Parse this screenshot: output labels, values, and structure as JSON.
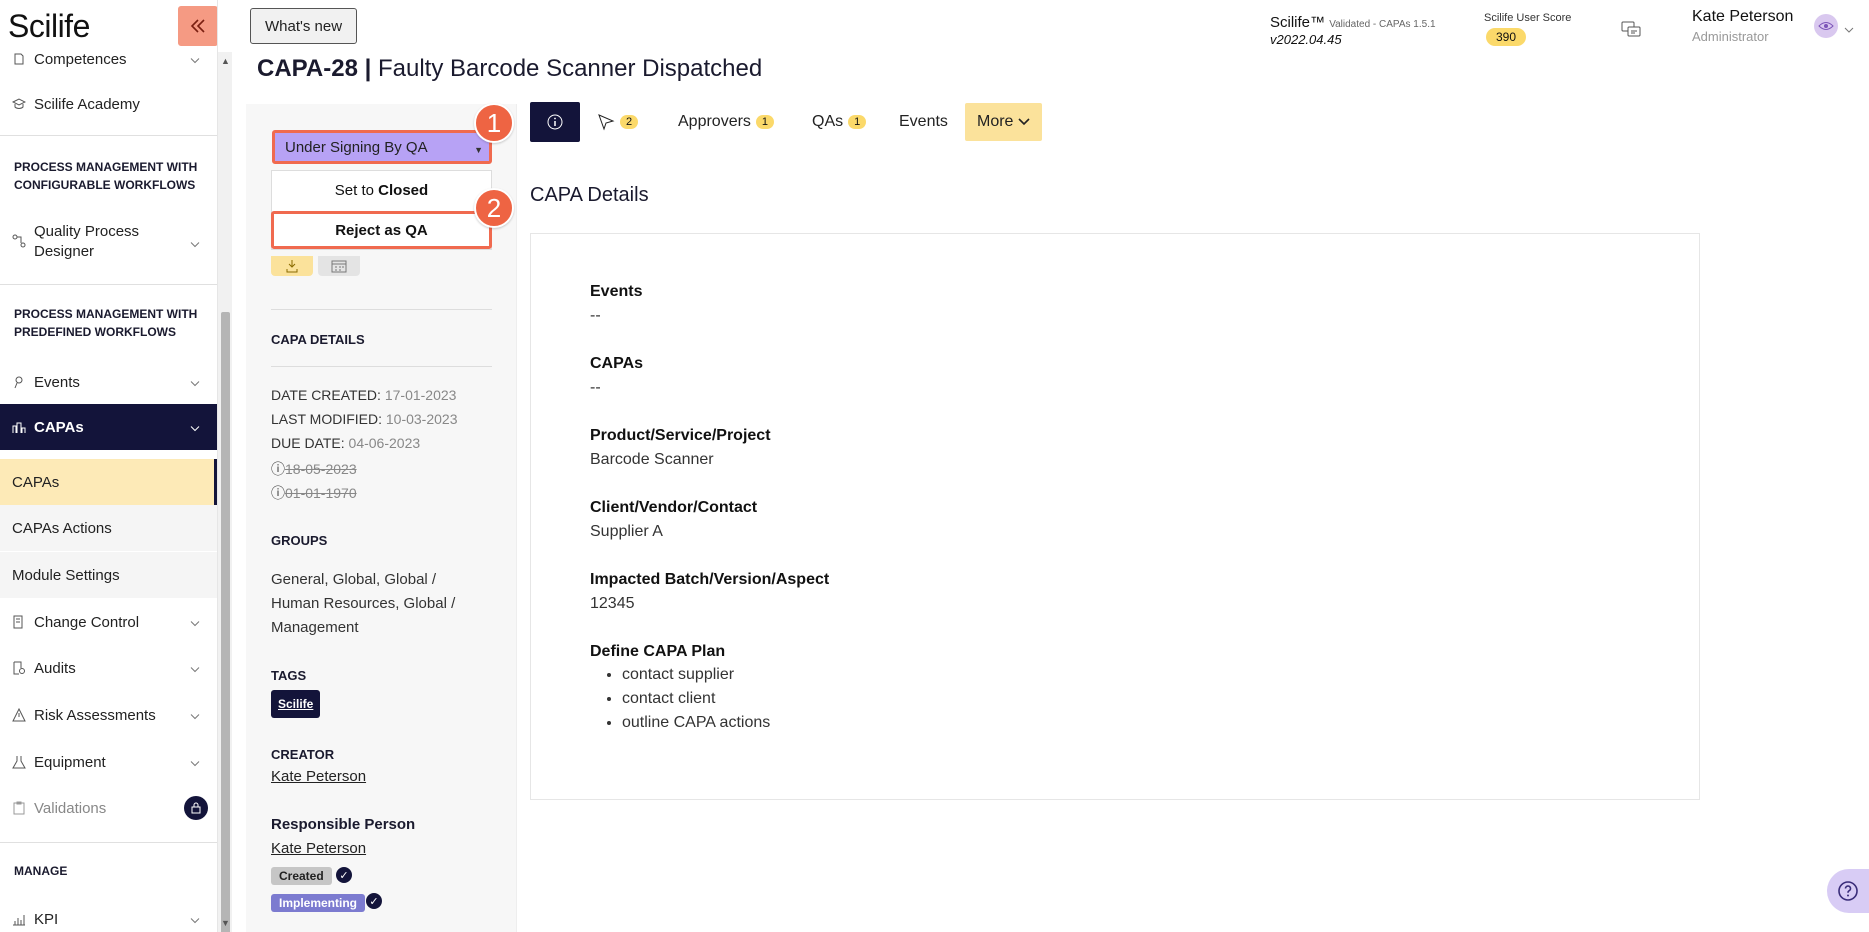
{
  "app": {
    "logo": "Scilife"
  },
  "sidebar": {
    "items_top": [
      {
        "label": "Competences"
      },
      {
        "label": "Scilife Academy"
      }
    ],
    "section_configurable": "PROCESS MANAGEMENT WITH CONFIGURABLE WORKFLOWS",
    "quality_designer": "Quality Process Designer",
    "section_predefined": "PROCESS MANAGEMENT WITH PREDEFINED WORKFLOWS",
    "events": "Events",
    "capas": "CAPAs",
    "sub": {
      "capas": "CAPAs",
      "capas_actions": "CAPAs Actions",
      "module_settings": "Module Settings"
    },
    "change_control": "Change Control",
    "audits": "Audits",
    "risk_assessments": "Risk Assessments",
    "equipment": "Equipment",
    "validations": "Validations",
    "section_manage": "MANAGE",
    "kpi": "KPI"
  },
  "topbar": {
    "whats_new": "What's new",
    "product": "Scilife™",
    "validated": "Validated - CAPAs 1.5.1",
    "version": "v2022.04.45",
    "score_label": "Scilife User Score",
    "score_value": "390",
    "user_name": "Kate Peterson",
    "user_role": "Administrator"
  },
  "page": {
    "id": "CAPA-28",
    "separator": "|",
    "title": "Faulty Barcode Scanner Dispatched"
  },
  "status": {
    "current": "Under Signing By QA",
    "option1_prefix": "Set to ",
    "option1_bold": "Closed",
    "option2": "Reject as QA",
    "callout1": "1",
    "callout2": "2"
  },
  "info": {
    "details_head": "CAPA DETAILS",
    "date_created_label": "DATE CREATED:",
    "date_created": "17-01-2023",
    "last_modified_label": "LAST MODIFIED:",
    "last_modified": "10-03-2023",
    "due_date_label": "DUE DATE:",
    "due_date": "04-06-2023",
    "struck1": "18-05-2023",
    "struck2": "01-01-1970",
    "groups_head": "GROUPS",
    "groups": "General, Global, Global / Human Resources, Global / Management",
    "tags_head": "TAGS",
    "tag": "Scilife",
    "creator_head": "CREATOR",
    "creator": "Kate Peterson",
    "responsible_head": "Responsible Person",
    "responsible": "Kate Peterson",
    "chip_created": "Created",
    "chip_implementing": "Implementing"
  },
  "tabs": {
    "tasks_count": "2",
    "approvers": "Approvers",
    "approvers_count": "1",
    "qas": "QAs",
    "qas_count": "1",
    "events": "Events",
    "more": "More"
  },
  "details": {
    "section_title": "CAPA Details",
    "events_label": "Events",
    "events_value": "--",
    "capas_label": "CAPAs",
    "capas_value": "--",
    "product_label": "Product/Service/Project",
    "product_value": "Barcode Scanner",
    "client_label": "Client/Vendor/Contact",
    "client_value": "Supplier A",
    "batch_label": "Impacted Batch/Version/Aspect",
    "batch_value": "12345",
    "plan_label": "Define CAPA Plan",
    "plan_items": [
      "contact supplier",
      "contact client",
      "outline CAPA actions"
    ]
  },
  "colors": {
    "navy": "#13143a",
    "accent": "#f06a4f",
    "status": "#b7a2f5",
    "yellow": "#fbd96a"
  }
}
